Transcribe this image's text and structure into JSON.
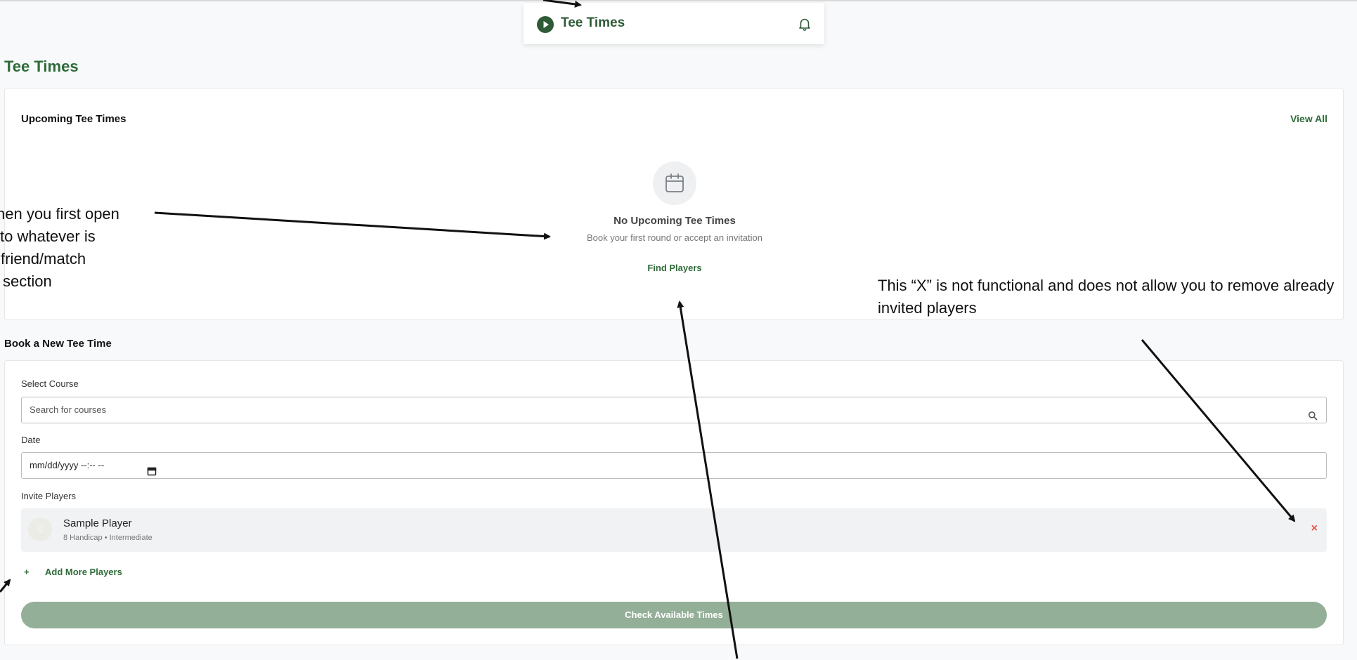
{
  "header": {
    "title": "Tee Times"
  },
  "page": {
    "title": "Tee Times"
  },
  "upcoming": {
    "title": "Upcoming Tee Times",
    "view_all_label": "View All",
    "empty_title": "No Upcoming Tee Times",
    "empty_subtitle": "Book your first round or accept an invitation",
    "find_players_label": "Find Players"
  },
  "book": {
    "title": "Book a New Tee Time",
    "course_label": "Select Course",
    "course_placeholder": "Search for courses",
    "date_label": "Date",
    "date_value": "mm/dd/yyyy --:-- --",
    "invite_label": "Invite Players",
    "player": {
      "initial": "S",
      "name": "Sample Player",
      "meta": "8 Handicap • Intermediate"
    },
    "remove_label": "×",
    "add_more_plus": "+",
    "add_more_label": "Add More Players",
    "check_button_label": "Check Available Times"
  },
  "annotations": {
    "left_lines": [
      "hen you first open",
      "to whatever is",
      "friend/match",
      "section"
    ],
    "right_text": "This “X” is not functional and does not allow you to remove already invited players"
  },
  "colors": {
    "brand_green": "#2e6b39",
    "button_disabled_green": "#94af97",
    "remove_red": "#e0524a"
  },
  "icons": {
    "logo": "play-circle-icon",
    "bell": "bell-icon",
    "empty": "calendar-icon",
    "search": "search-icon",
    "date": "calendar-small-icon",
    "remove": "close-icon"
  }
}
